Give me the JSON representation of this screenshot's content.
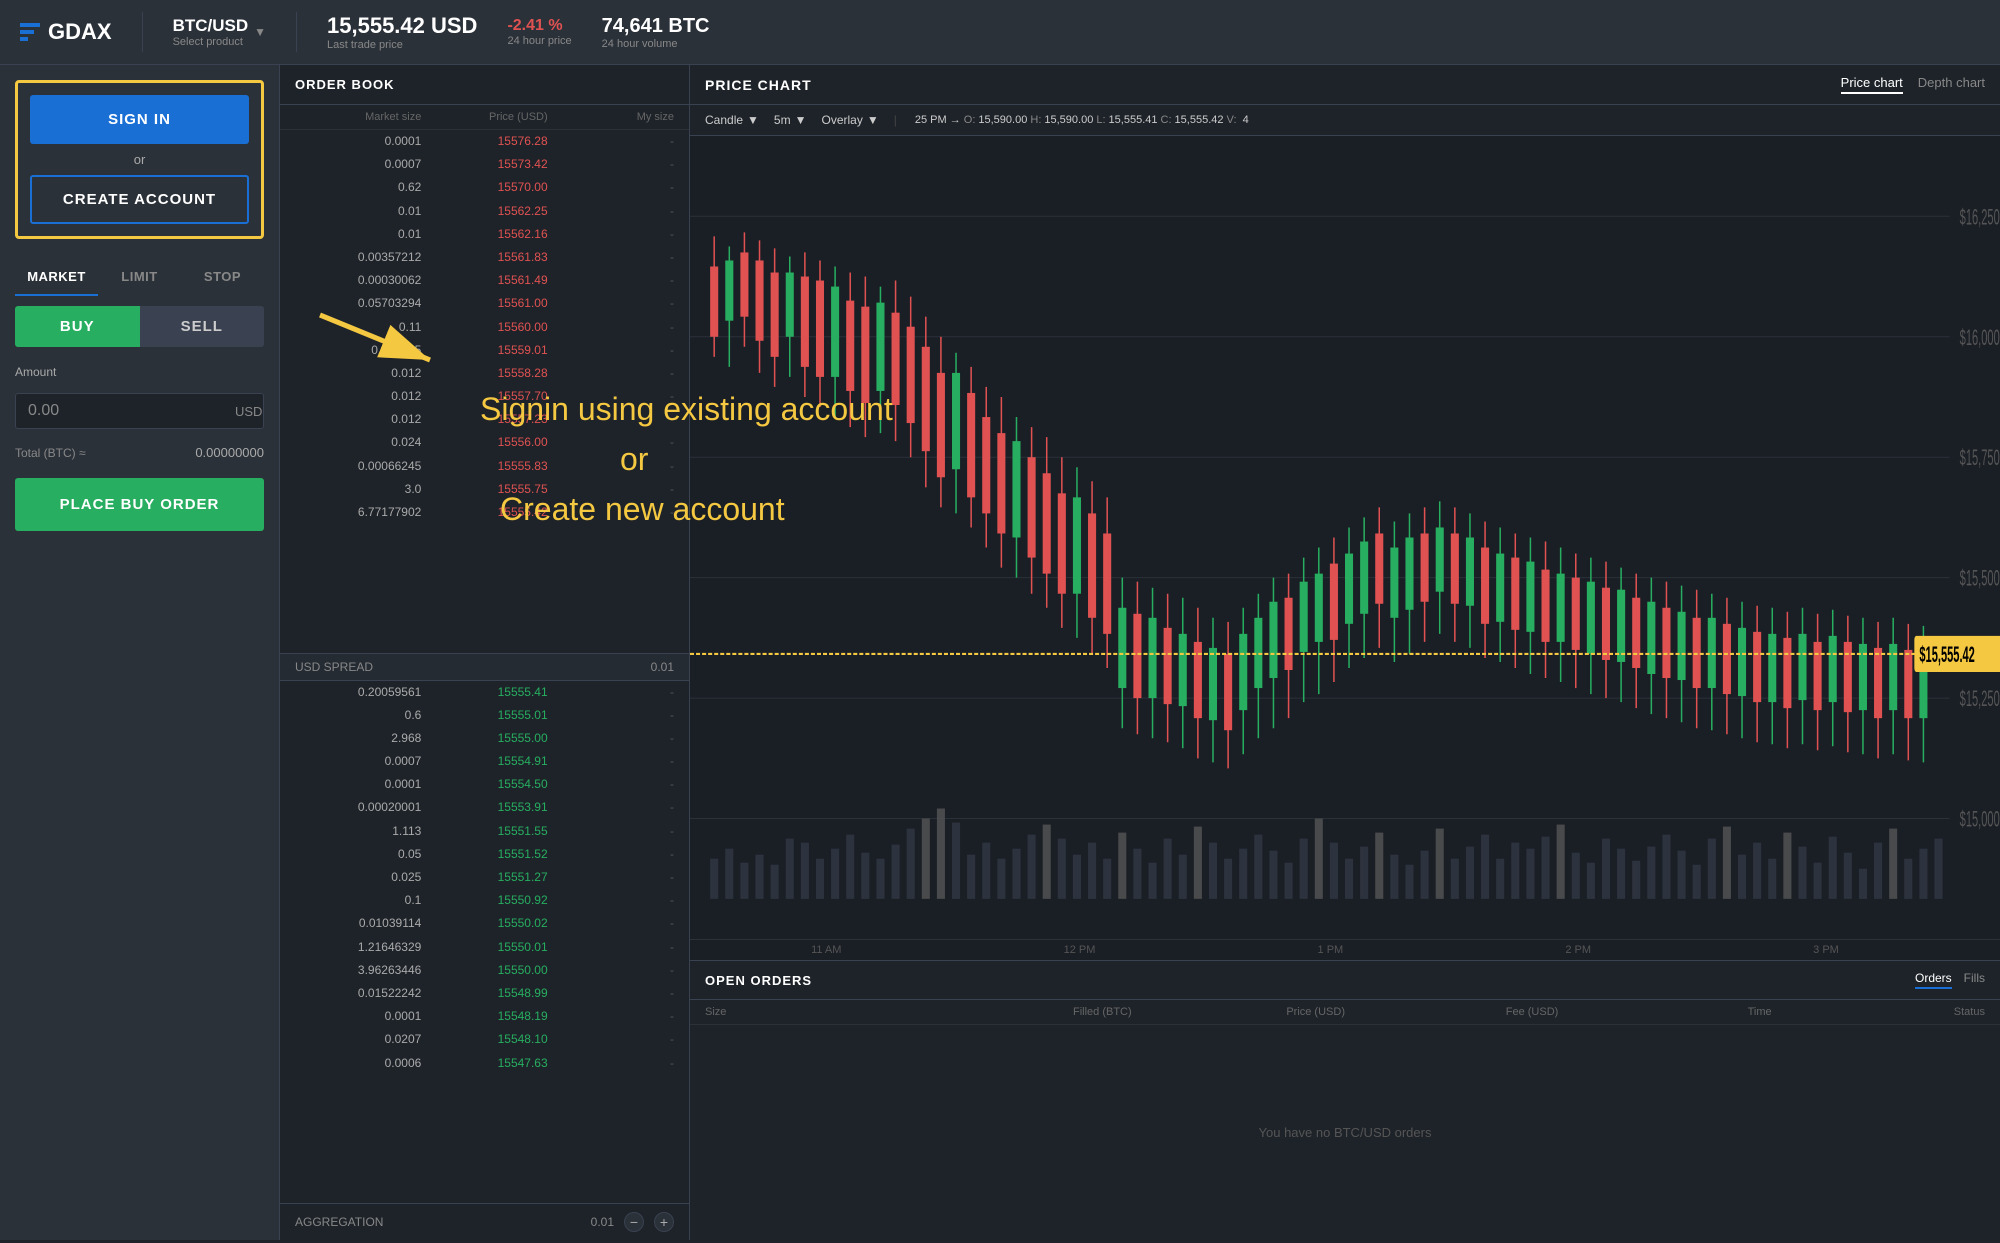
{
  "header": {
    "logo": "GDAX",
    "product": "BTC/USD",
    "product_sub": "Select product",
    "price": "15,555.42 USD",
    "price_label": "Last trade price",
    "change": "-2.41 %",
    "change_label": "24 hour price",
    "volume": "74,641 BTC",
    "volume_label": "24 hour volume"
  },
  "left_panel": {
    "signin_label": "SIGN IN",
    "or_label": "or",
    "create_account_label": "CREATE ACCOUNT",
    "tabs": [
      "MARKET",
      "LIMIT",
      "STOP"
    ],
    "active_tab": "MARKET",
    "buy_label": "BUY",
    "sell_label": "SELL",
    "amount_label": "Amount",
    "amount_value": "0.00",
    "amount_currency": "USD",
    "total_label": "Total (BTC) ≈",
    "total_value": "0.00000000",
    "place_order_label": "PLACE BUY ORDER"
  },
  "order_book": {
    "title": "ORDER BOOK",
    "col_market": "Market size",
    "col_price": "Price (USD)",
    "col_my": "My size",
    "ask_rows": [
      {
        "market": "0.0001",
        "price": "15576.28",
        "my": "-"
      },
      {
        "market": "0.0007",
        "price": "15573.42",
        "my": "-"
      },
      {
        "market": "0.62",
        "price": "15570.00",
        "my": "-"
      },
      {
        "market": "0.01",
        "price": "15562.25",
        "my": "-"
      },
      {
        "market": "0.01",
        "price": "15562.16",
        "my": "-"
      },
      {
        "market": "0.00357212",
        "price": "15561.83",
        "my": "-"
      },
      {
        "market": "0.00030062",
        "price": "15561.49",
        "my": "-"
      },
      {
        "market": "0.05703294",
        "price": "15561.00",
        "my": "-"
      },
      {
        "market": "0.11",
        "price": "15560.00",
        "my": "-"
      },
      {
        "market": "0.552395",
        "price": "15559.01",
        "my": "-"
      },
      {
        "market": "0.012",
        "price": "15558.28",
        "my": "-"
      },
      {
        "market": "0.012",
        "price": "15557.70",
        "my": "-"
      },
      {
        "market": "0.012",
        "price": "15557.23",
        "my": "-"
      },
      {
        "market": "0.024",
        "price": "15556.00",
        "my": "-"
      },
      {
        "market": "0.00066245",
        "price": "15555.83",
        "my": "-"
      },
      {
        "market": "3.0",
        "price": "15555.75",
        "my": "-"
      },
      {
        "market": "6.77177902",
        "price": "15555.42",
        "my": "-"
      }
    ],
    "spread_label": "USD SPREAD",
    "spread_value": "0.01",
    "bid_rows": [
      {
        "market": "0.20059561",
        "price": "15555.41",
        "my": "-"
      },
      {
        "market": "0.6",
        "price": "15555.01",
        "my": "-"
      },
      {
        "market": "2.968",
        "price": "15555.00",
        "my": "-"
      },
      {
        "market": "0.0007",
        "price": "15554.91",
        "my": "-"
      },
      {
        "market": "0.0001",
        "price": "15554.50",
        "my": "-"
      },
      {
        "market": "0.00020001",
        "price": "15553.91",
        "my": "-"
      },
      {
        "market": "1.113",
        "price": "15551.55",
        "my": "-"
      },
      {
        "market": "0.05",
        "price": "15551.52",
        "my": "-"
      },
      {
        "market": "0.025",
        "price": "15551.27",
        "my": "-"
      },
      {
        "market": "0.1",
        "price": "15550.92",
        "my": "-"
      },
      {
        "market": "0.01039114",
        "price": "15550.02",
        "my": "-"
      },
      {
        "market": "1.21646329",
        "price": "15550.01",
        "my": "-"
      },
      {
        "market": "3.96263446",
        "price": "15550.00",
        "my": "-"
      },
      {
        "market": "0.01522242",
        "price": "15548.99",
        "my": "-"
      },
      {
        "market": "0.0001",
        "price": "15548.19",
        "my": "-"
      },
      {
        "market": "0.0207",
        "price": "15548.10",
        "my": "-"
      },
      {
        "market": "0.0006",
        "price": "15547.63",
        "my": "-"
      }
    ],
    "aggregation_label": "AGGREGATION",
    "aggregation_value": "0.01"
  },
  "chart": {
    "title": "PRICE CHART",
    "tab_price": "Price chart",
    "tab_depth": "Depth chart",
    "candle_label": "Candle",
    "interval": "5m",
    "overlay": "Overlay",
    "ohlc_time": "25 PM →",
    "ohlc_o": "15,590.00",
    "ohlc_h": "15,590.00",
    "ohlc_l": "15,555.41",
    "ohlc_c": "15,555.42",
    "ohlc_v": "4",
    "price_marker": "$15,555.42",
    "time_labels": [
      "11 AM",
      "12 PM",
      "1 PM",
      "2 PM",
      "3 PM"
    ],
    "y_labels": [
      "$16,250",
      "$16,000",
      "$15,750",
      "$15,500",
      "$15,250",
      "$15,000"
    ]
  },
  "open_orders": {
    "title": "OPEN ORDERS",
    "tab_orders": "Orders",
    "tab_fills": "Fills",
    "col_size": "Size",
    "col_filled": "Filled (BTC)",
    "col_price": "Price (USD)",
    "col_fee": "Fee (USD)",
    "col_time": "Time",
    "col_status": "Status",
    "empty_message": "You have no BTC/USD orders"
  },
  "annotation": {
    "text1": "Signin using existing account",
    "text2": "or",
    "text3": "Create new account"
  }
}
